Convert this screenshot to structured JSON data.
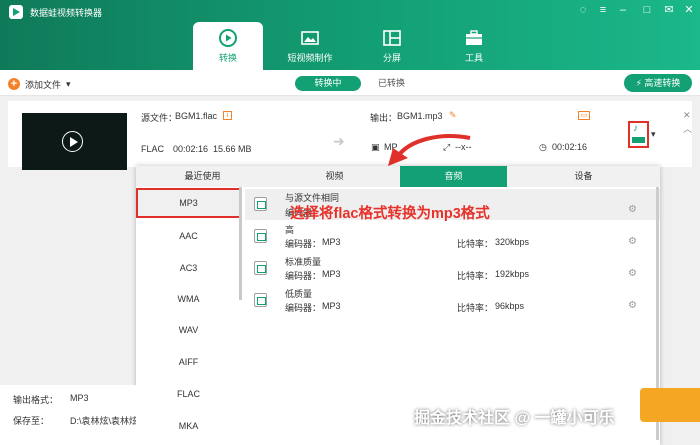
{
  "app": {
    "title": "数据蛙视频转换器"
  },
  "nav": [
    "转换",
    "短视频制作",
    "分屏",
    "工具"
  ],
  "toolbar": {
    "add_file": "添加文件",
    "seg_converting": "转换中",
    "seg_converted": "已转换",
    "fast_convert": "高速转换"
  },
  "file": {
    "source_label": "源文件：",
    "source_name": "BGM1.flac",
    "output_label": "输出：",
    "output_name": "BGM1.mp3",
    "src_format": "FLAC",
    "src_duration": "00:02:16",
    "src_size": "15.66 MB",
    "out_format": "MP",
    "out_extra": "--x--",
    "out_duration": "00:02:16"
  },
  "popup": {
    "tabs": [
      "最近使用",
      "视频",
      "音频",
      "设备"
    ],
    "formats": [
      "MP3",
      "AAC",
      "AC3",
      "WMA",
      "WAV",
      "AIFF",
      "FLAC",
      "MKA"
    ],
    "qualities": [
      {
        "name": "与源文件相同",
        "encoder": "编码器：",
        "enc_val": "",
        "bitrate_label": "",
        "bitrate": ""
      },
      {
        "name": "高",
        "encoder": "编码器：",
        "enc_val": "MP3",
        "bitrate_label": "比特率：",
        "bitrate": "320kbps"
      },
      {
        "name": "标准质量",
        "encoder": "编码器：",
        "enc_val": "MP3",
        "bitrate_label": "比特率：",
        "bitrate": "192kbps"
      },
      {
        "name": "低质量",
        "encoder": "编码器：",
        "enc_val": "MP3",
        "bitrate_label": "比特率：",
        "bitrate": "96kbps"
      }
    ]
  },
  "annotation": "选择将flac格式转换为mp3格式",
  "bottom": {
    "output_format_label": "输出格式：",
    "output_format_value": "MP3",
    "save_to_label": "保存至：",
    "save_to_value": "D:\\袁林炫\\袁林炫"
  },
  "watermark": "掘金技术社区 @ 一罐小可乐",
  "colors": {
    "accent": "#13a075",
    "highlight": "#e0302a",
    "orange": "#f5822a"
  }
}
